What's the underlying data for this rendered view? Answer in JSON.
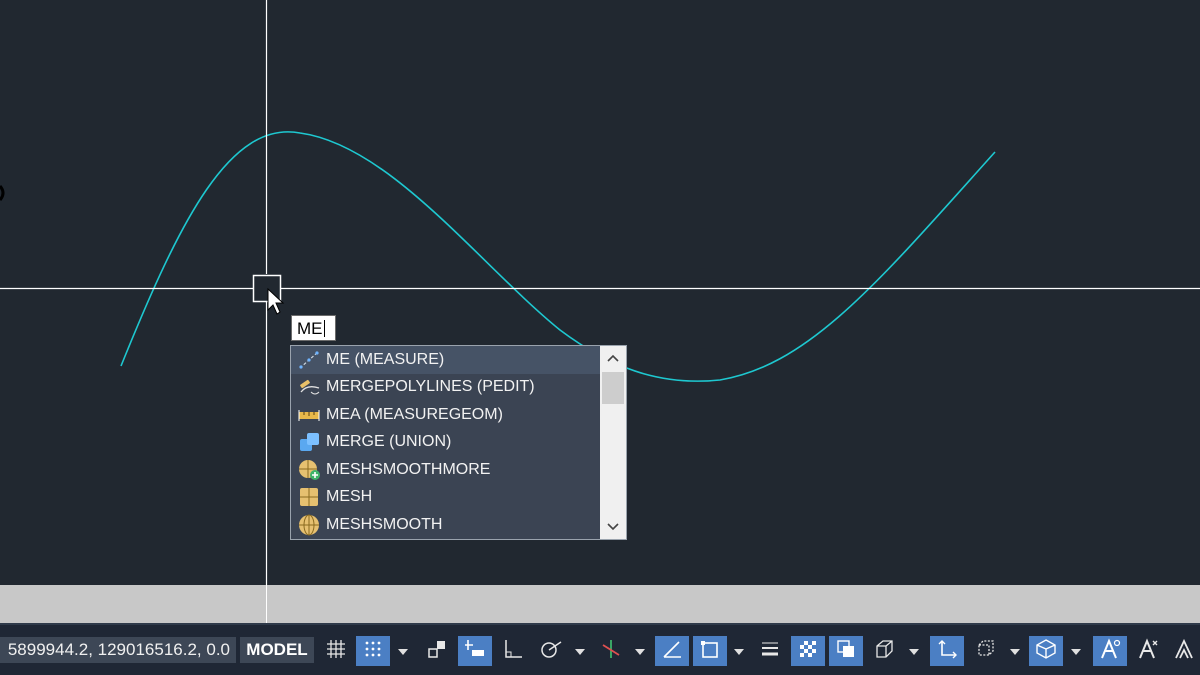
{
  "command_line": {
    "input_value": "ME"
  },
  "autocomplete": {
    "items": [
      {
        "label": "ME (MEASURE)",
        "icon": "measure-icon",
        "selected": true
      },
      {
        "label": "MERGEPOLYLINES (PEDIT)",
        "icon": "pedit-icon"
      },
      {
        "label": "MEA (MEASUREGEOM)",
        "icon": "measuregeom-icon"
      },
      {
        "label": "MERGE (UNION)",
        "icon": "union-icon"
      },
      {
        "label": "MESHSMOOTHMORE",
        "icon": "meshsmoothmore-icon"
      },
      {
        "label": "MESH",
        "icon": "mesh-icon"
      },
      {
        "label": "MESHSMOOTH",
        "icon": "meshsmooth-icon"
      }
    ]
  },
  "status_bar": {
    "coordinates": "5899944.2, 129016516.2, 0.0",
    "model_label": "MODEL"
  },
  "colors": {
    "canvas_bg": "#212830",
    "spline": "#1ec8d0",
    "crosshair": "#ffffff",
    "accent_on": "#4b7fc4"
  }
}
